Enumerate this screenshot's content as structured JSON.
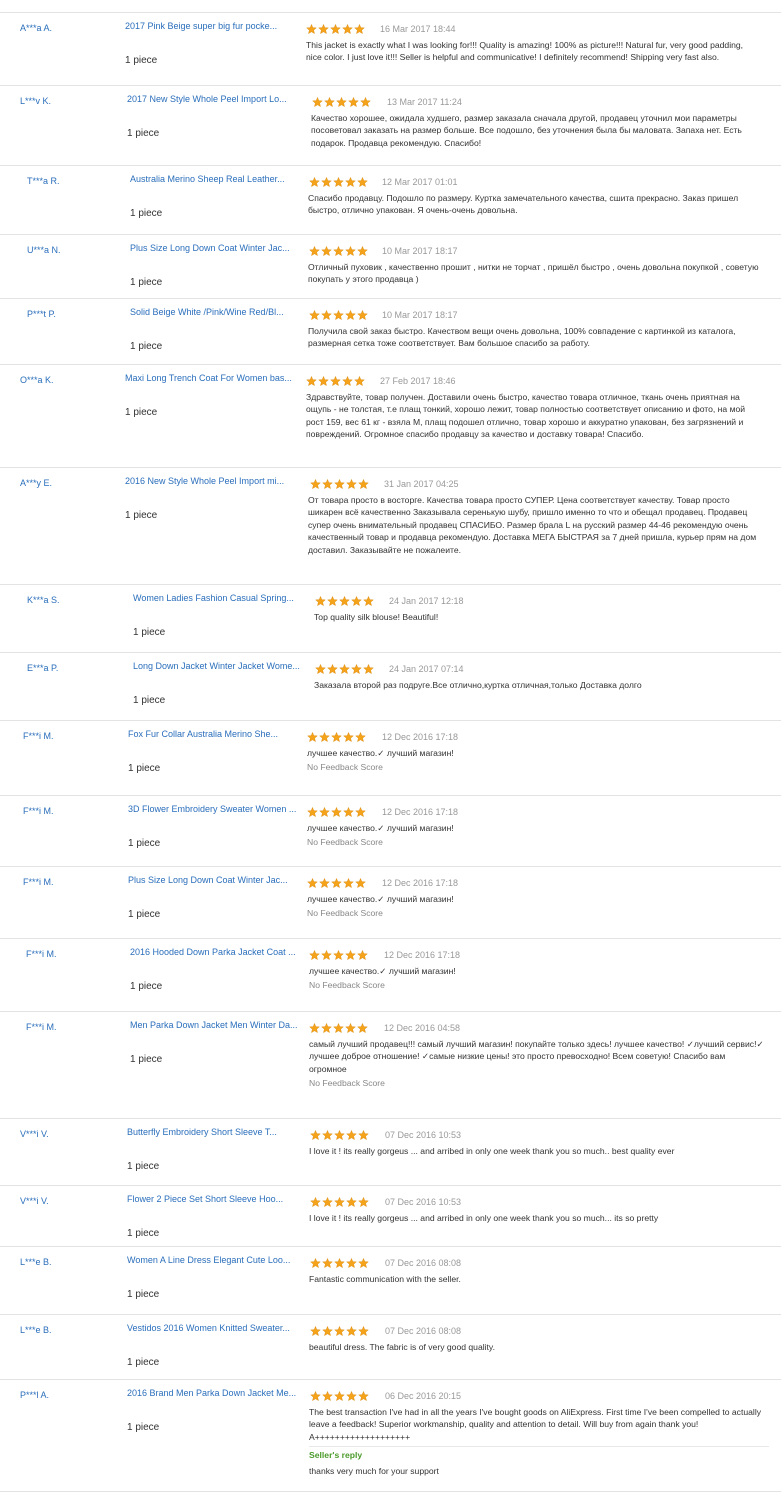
{
  "colors": {
    "star": "#f5a31b",
    "link": "#2a6ebb",
    "reply": "#4a9a2a",
    "separator": "#e3e3e3"
  },
  "icons": {
    "rating_star": "star-icon"
  },
  "feedback": [
    {
      "buyer": "A***a A.",
      "product": "2017 Pink Beige super big fur pocke...",
      "quantity": "1 piece",
      "rating": 5,
      "date": "16 Mar 2017 18:44",
      "comment": "This jacket is exactly what I was looking for!!! Quality is amazing! 100% as picture!!! Natural fur, very good padding, nice color. I just love it!!! Seller is helpful and communicative! I definitely recommend! Shipping very fast also."
    },
    {
      "buyer": "L***v K.",
      "product": "2017 New Style Whole Peel Import Lo...",
      "quantity": "1 piece",
      "rating": 5,
      "date": "13 Mar 2017 11:24",
      "comment": "Качество хорошее, ожидала худшего, размер заказала сначала другой, продавец уточнил мои параметры посоветовал заказать на размер больше. Все подошло, без уточнения была бы маловата. Запаха нет. Есть подарок. Продавца рекомендую. Спасибо!"
    },
    {
      "buyer": "T***a R.",
      "product": "Australia Merino Sheep Real Leather...",
      "quantity": "1 piece",
      "rating": 5,
      "date": "12 Mar 2017 01:01",
      "comment": "Спасибо продавцу. Подошло по размеру. Куртка замечательного качества, сшита прекрасно. Заказ пришел быстро, отлично упакован. Я очень-очень довольна."
    },
    {
      "buyer": "U***a N.",
      "product": "Plus Size Long Down Coat Winter Jac...",
      "quantity": "1 piece",
      "rating": 5,
      "date": "10 Mar 2017 18:17",
      "comment": "Отличный пуховик , качественно прошит , нитки не торчат , пришёл быстро , очень довольна покупкой , советую покупать у этого продавца )"
    },
    {
      "buyer": "P***t P.",
      "product": "Solid Beige White /Pink/Wine Red/Bl...",
      "quantity": "1 piece",
      "rating": 5,
      "date": "10 Mar 2017 18:17",
      "comment": "Получила свой заказ быстро. Качеством вещи очень довольна, 100% совпадение с картинкой из каталога, размерная сетка тоже соответствует. Вам большое спасибо за работу."
    },
    {
      "buyer": "O***a K.",
      "product": "Maxi Long Trench Coat For Women bas...",
      "quantity": "1 piece",
      "rating": 5,
      "date": "27 Feb 2017 18:46",
      "comment": "Здравствуйте, товар получен. Доставили очень быстро, качество товара отличное, ткань очень приятная на ощупь - не толстая, т.е плащ тонкий, хорошо лежит, товар полностью соответствует описанию и фото, на мой рост 159, вес 61 кг - взяла М, плащ подошел отлично, товар хорошо и аккуратно упакован, без загрязнений и повреждений. Огромное спасибо продавцу за качество и доставку товара! Спасибо."
    },
    {
      "buyer": "A***y E.",
      "product": "2016 New Style Whole Peel Import mi...",
      "quantity": "1 piece",
      "rating": 5,
      "date": "31 Jan 2017 04:25",
      "comment": "От товара просто в восторге. Качества товара просто СУПЕР. Цена соответствует качеству. Товар просто шикарен всё качественно Заказывала серенькую шубу, пришло именно то что и обещал продавец. Продавец супер очень внимательный продавец СПАСИБО. Размер брала L на русский размер 44-46 рекомендую очень качественный товар и продавца рекомендую. Доставка МЕГА БЫСТРАЯ за 7 дней пришла, курьер прям на дом доставил. Заказывайте не пожалеите."
    },
    {
      "buyer": "K***a S.",
      "product": "Women Ladies Fashion Casual Spring...",
      "quantity": "1 piece",
      "rating": 5,
      "date": "24 Jan 2017 12:18",
      "comment": "Top quality silk blouse! Beautiful!"
    },
    {
      "buyer": "E***a P.",
      "product": "Long Down Jacket Winter Jacket Wome...",
      "quantity": "1 piece",
      "rating": 5,
      "date": "24 Jan 2017 07:14",
      "comment": "Заказала второй раз подруге.Все отлично,куртка отличная,только Доставка долго"
    },
    {
      "buyer": "F***i M.",
      "product": "Fox Fur Collar Australia Merino She...",
      "quantity": "1 piece",
      "rating": 5,
      "date": "12 Dec 2016 17:18",
      "comment": "лучшее качество.✓ лучший магазин!",
      "note": "No Feedback Score"
    },
    {
      "buyer": "F***i M.",
      "product": "3D Flower Embroidery Sweater Women ...",
      "quantity": "1 piece",
      "rating": 5,
      "date": "12 Dec 2016 17:18",
      "comment": "лучшее качество.✓ лучший магазин!",
      "note": "No Feedback Score"
    },
    {
      "buyer": "F***i M.",
      "product": "Plus Size Long Down Coat Winter Jac...",
      "quantity": "1 piece",
      "rating": 5,
      "date": "12 Dec 2016 17:18",
      "comment": "лучшее качество.✓ лучший магазин!",
      "note": "No Feedback Score"
    },
    {
      "buyer": "F***i M.",
      "product": "2016 Hooded Down Parka Jacket Coat ...",
      "quantity": "1 piece",
      "rating": 5,
      "date": "12 Dec 2016 17:18",
      "comment": "лучшее качество.✓ лучший магазин!",
      "note": "No Feedback Score"
    },
    {
      "buyer": "F***i M.",
      "product": "Men Parka Down Jacket Men Winter Da...",
      "quantity": "1 piece",
      "rating": 5,
      "date": "12 Dec 2016 04:58",
      "comment": "самый лучший продавец!!! самый лучший магазин! покупайте только здесь! лучшее качество! ✓лучший сервис!✓ лучшее доброе отношение! ✓самые низкие цены! это просто превосходно! Всем советую! Спасибо вам огромное",
      "note": "No Feedback Score"
    },
    {
      "buyer": "V***i V.",
      "product": "Butterfly Embroidery Short Sleeve T...",
      "quantity": "1 piece",
      "rating": 5,
      "date": "07 Dec 2016 10:53",
      "comment": "I love it ! its really gorgeus ... and arribed in only one week thank you so much.. best quality ever"
    },
    {
      "buyer": "V***i V.",
      "product": "Flower 2 Piece Set Short Sleeve Hoo...",
      "quantity": "1 piece",
      "rating": 5,
      "date": "07 Dec 2016 10:53",
      "comment": "I love it ! its really gorgeus ... and arribed in only one week thank you so much... its so pretty"
    },
    {
      "buyer": "L***e B.",
      "product": "Women A Line Dress Elegant Cute Loo...",
      "quantity": "1 piece",
      "rating": 5,
      "date": "07 Dec 2016 08:08",
      "comment": "Fantastic communication with the seller."
    },
    {
      "buyer": "L***e B.",
      "product": "Vestidos 2016 Women Knitted Sweater...",
      "quantity": "1 piece",
      "rating": 5,
      "date": "07 Dec 2016 08:08",
      "comment": "beautiful dress. The fabric is of very good quality."
    },
    {
      "buyer": "P***l A.",
      "product": "2016 Brand Men Parka Down Jacket Me...",
      "quantity": "1 piece",
      "rating": 5,
      "date": "06 Dec 2016 20:15",
      "comment": "The best transaction I've had in all the years I've bought goods on AliExpress. First time I've been compelled to actually leave a feedback! Superior workmanship, quality and attention to detail. Will buy from again thank you! A+++++++++++++++++++",
      "reply_title": "Seller's reply",
      "reply": "thanks very much for your support"
    }
  ]
}
